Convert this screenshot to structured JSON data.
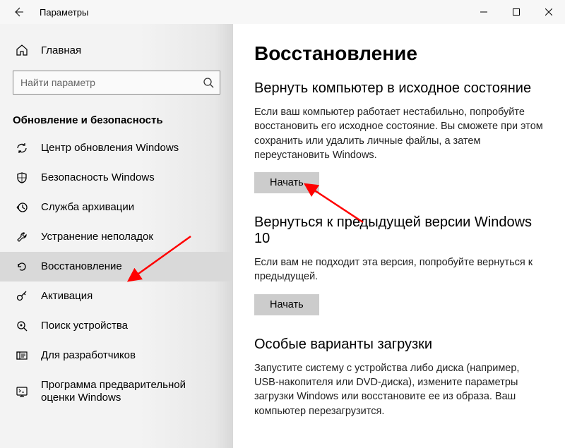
{
  "titlebar": {
    "title": "Параметры"
  },
  "sidebar": {
    "home": "Главная",
    "search_placeholder": "Найти параметр",
    "section": "Обновление и безопасность",
    "items": [
      {
        "label": "Центр обновления Windows"
      },
      {
        "label": "Безопасность Windows"
      },
      {
        "label": "Служба архивации"
      },
      {
        "label": "Устранение неполадок"
      },
      {
        "label": "Восстановление"
      },
      {
        "label": "Активация"
      },
      {
        "label": "Поиск устройства"
      },
      {
        "label": "Для разработчиков"
      },
      {
        "label": "Программа предварительной оценки Windows"
      }
    ]
  },
  "main": {
    "title": "Восстановление",
    "sections": [
      {
        "heading": "Вернуть компьютер в исходное состояние",
        "body": "Если ваш компьютер работает нестабильно, попробуйте восстановить его исходное состояние. Вы сможете при этом сохранить или удалить личные файлы, а затем переустановить Windows.",
        "button": "Начать"
      },
      {
        "heading": "Вернуться к предыдущей версии Windows 10",
        "body": "Если вам не подходит эта версия, попробуйте вернуться к предыдущей.",
        "button": "Начать"
      },
      {
        "heading": "Особые варианты загрузки",
        "body": "Запустите систему с устройства либо диска (например, USB-накопителя или DVD-диска), измените параметры загрузки Windows или восстановите ее из образа. Ваш компьютер перезагрузится."
      }
    ]
  }
}
